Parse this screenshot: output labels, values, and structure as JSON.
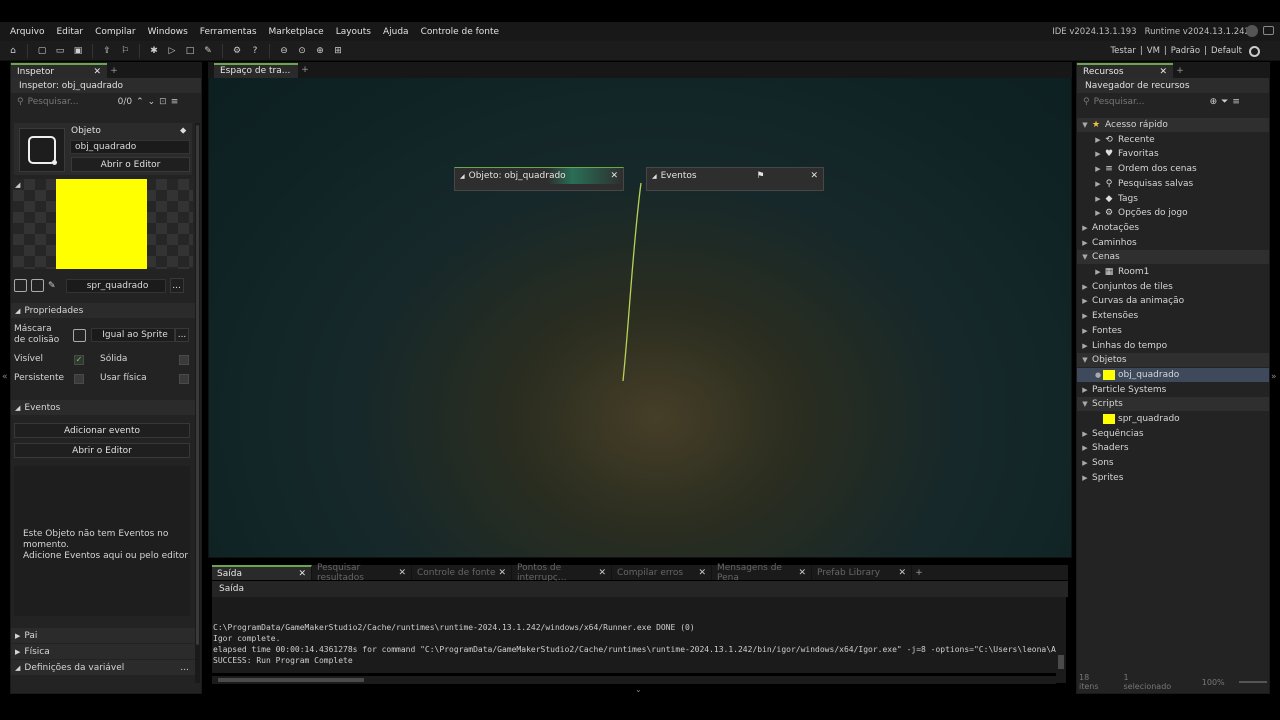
{
  "menu": [
    "Arquivo",
    "Editar",
    "Compilar",
    "Windows",
    "Ferramentas",
    "Marketplace",
    "Layouts",
    "Ajuda",
    "Controle de fonte"
  ],
  "versions": {
    "ide": "IDE v2024.13.1.193",
    "runtime": "Runtime v2024.13.1.242"
  },
  "target": {
    "testar": "Testar",
    "sep": "|",
    "vm": "VM",
    "padrao": "Padrão",
    "default": "Default"
  },
  "inspector": {
    "tab": "Inspetor",
    "title": "Inspetor: obj_quadrado",
    "search_placeholder": "Pesquisar...",
    "count": "0/0",
    "object_label": "Objeto",
    "object_name": "obj_quadrado",
    "open_editor": "Abrir o Editor",
    "sprite_name": "spr_quadrado",
    "properties": "Propriedades",
    "collision_mask": "Máscara de colisão",
    "collision_value": "Igual ao Sprite",
    "visible": "Visível",
    "solid": "Sólida",
    "persistent": "Persistente",
    "physics": "Usar física",
    "events": "Eventos",
    "add_event": "Adicionar evento",
    "open_editor2": "Abrir o Editor",
    "empty_msg1": "Este Objeto não tem Eventos no momento.",
    "empty_msg2": "Adicione Eventos aqui ou pelo editor",
    "parent": "Pai",
    "physics_sect": "Física",
    "var_defs": "Definições da variável",
    "dots": "..."
  },
  "workspace": {
    "tab": "Espaço de tra...",
    "node_object": "Objeto: obj_quadrado",
    "node_events": "Eventos"
  },
  "resources": {
    "tab": "Recursos",
    "title": "Navegador de recursos",
    "search_placeholder": "Pesquisar...",
    "items": [
      {
        "label": "Acesso rápido",
        "level": 0,
        "open": true,
        "hdr": true,
        "icon": "★"
      },
      {
        "label": "Recente",
        "level": 1,
        "icon": "⟲"
      },
      {
        "label": "Favoritas",
        "level": 1,
        "icon": "♥"
      },
      {
        "label": "Ordem dos cenas",
        "level": 1,
        "icon": "≡"
      },
      {
        "label": "Pesquisas salvas",
        "level": 1,
        "icon": "⚲"
      },
      {
        "label": "Tags",
        "level": 1,
        "icon": "◆"
      },
      {
        "label": "Opções do jogo",
        "level": 1,
        "icon": "⚙"
      },
      {
        "label": "Anotações",
        "level": 0
      },
      {
        "label": "Caminhos",
        "level": 0
      },
      {
        "label": "Cenas",
        "level": 0,
        "open": true,
        "hdr": true
      },
      {
        "label": "Room1",
        "level": 1,
        "icon": "▦"
      },
      {
        "label": "Conjuntos de tiles",
        "level": 0
      },
      {
        "label": "Curvas da animação",
        "level": 0
      },
      {
        "label": "Extensões",
        "level": 0
      },
      {
        "label": "Fontes",
        "level": 0
      },
      {
        "label": "Linhas do tempo",
        "level": 0
      },
      {
        "label": "Objetos",
        "level": 0,
        "open": true,
        "hdr": true
      },
      {
        "label": "obj_quadrado",
        "level": 1,
        "sel": true,
        "swatch": true
      },
      {
        "label": "Particle Systems",
        "level": 0
      },
      {
        "label": "Scripts",
        "level": 0,
        "open": true,
        "hdr": true
      },
      {
        "label": "spr_quadrado",
        "level": 1,
        "swatch": true
      },
      {
        "label": "Sequências",
        "level": 0
      },
      {
        "label": "Shaders",
        "level": 0
      },
      {
        "label": "Sons",
        "level": 0
      },
      {
        "label": "Sprites",
        "level": 0
      }
    ],
    "footer": {
      "items": "18 itens",
      "selected": "1 selecionado",
      "zoom": "100%"
    }
  },
  "output": {
    "tabs": [
      "Saída",
      "Pesquisar resultados",
      "Controle de fonte",
      "Pontos de interrupç...",
      "Compilar erros",
      "Mensagens de Pena",
      "Prefab Library"
    ],
    "title": "Saída",
    "lines": [
      "C:\\ProgramData/GameMakerStudio2/Cache/runtimes\\runtime-2024.13.1.242/windows/x64/Runner.exe DONE (0)",
      "Igor complete.",
      "elapsed time 00:00:14.4361278s for command \"C:\\ProgramData/GameMakerStudio2/Cache/runtimes\\runtime-2024.13.1.242/bin/igor/windows/x64/Igor.exe\" -j=8  -options=\"C:\\Users\\leona\\AppDat",
      "SUCCESS: Run Program Complete"
    ]
  },
  "colors": {
    "accent": "#6aa64b",
    "sprite": "#ffff00",
    "selected": "#3e4a5c"
  }
}
